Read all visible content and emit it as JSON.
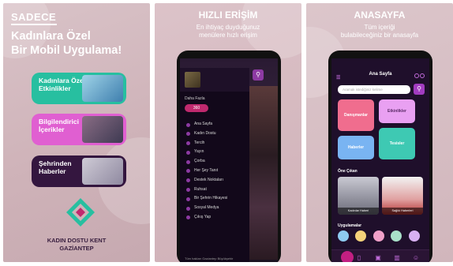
{
  "panel1": {
    "brand": "SADECE",
    "headline_1": "Kadınlara Özel",
    "headline_2": "Bir Mobil Uygulama!",
    "features": [
      {
        "label": "Kadınlara Özel Etkinlikler",
        "color": "#27bfa0"
      },
      {
        "label": "Bilgilendirici İçerikler",
        "color": "#e05fd1"
      },
      {
        "label": "Şehrinden Haberler",
        "color": "#34163f"
      }
    ],
    "footer_1": "KADIN DOSTU KENT",
    "footer_2": "GAZİANTEP"
  },
  "panel2": {
    "title": "HIZLI ERİŞİM",
    "subtitle_1": "En ihtiyaç duyduğunuz",
    "subtitle_2": "menülere hızlı erişim",
    "drawer": {
      "section_label": "Daha Fazla",
      "pill": "360",
      "items": [
        "Ana Sayfa",
        "Kadın Dostu",
        "Tercih",
        "Yayın",
        "Çorba",
        "Her Şey Tanıt",
        "Destek Noktaları",
        "Ruhsat",
        "Bir Şehrin Hikayesi",
        "Sosyal Medya",
        "Çıkış Yap"
      ],
      "footer": "Tüm hakları Gaziantep Büyükşehir"
    }
  },
  "panel3": {
    "title": "ANASAYFA",
    "subtitle_1": "Tüm içeriği",
    "subtitle_2": "bulabileceğiniz bir anasayfa",
    "appbar_title": "Ana Sayfa",
    "search_placeholder": "Aramak istediğiniz kelime",
    "tiles": [
      "Danışmanlar",
      "Etkinlikler",
      "Haberler",
      "Tesisler"
    ],
    "section_news": "Öne Çıkan",
    "news": [
      {
        "caption": "Kadınlar Haberi"
      },
      {
        "caption": "Sağlık Haberleri"
      }
    ],
    "section_apps": "Uygulamalar"
  },
  "colors": {
    "teal": "#27bfa0",
    "pink": "#e05fd1",
    "deep_purple": "#34163f",
    "accent": "#a23cc0",
    "magenta": "#c21f82"
  }
}
